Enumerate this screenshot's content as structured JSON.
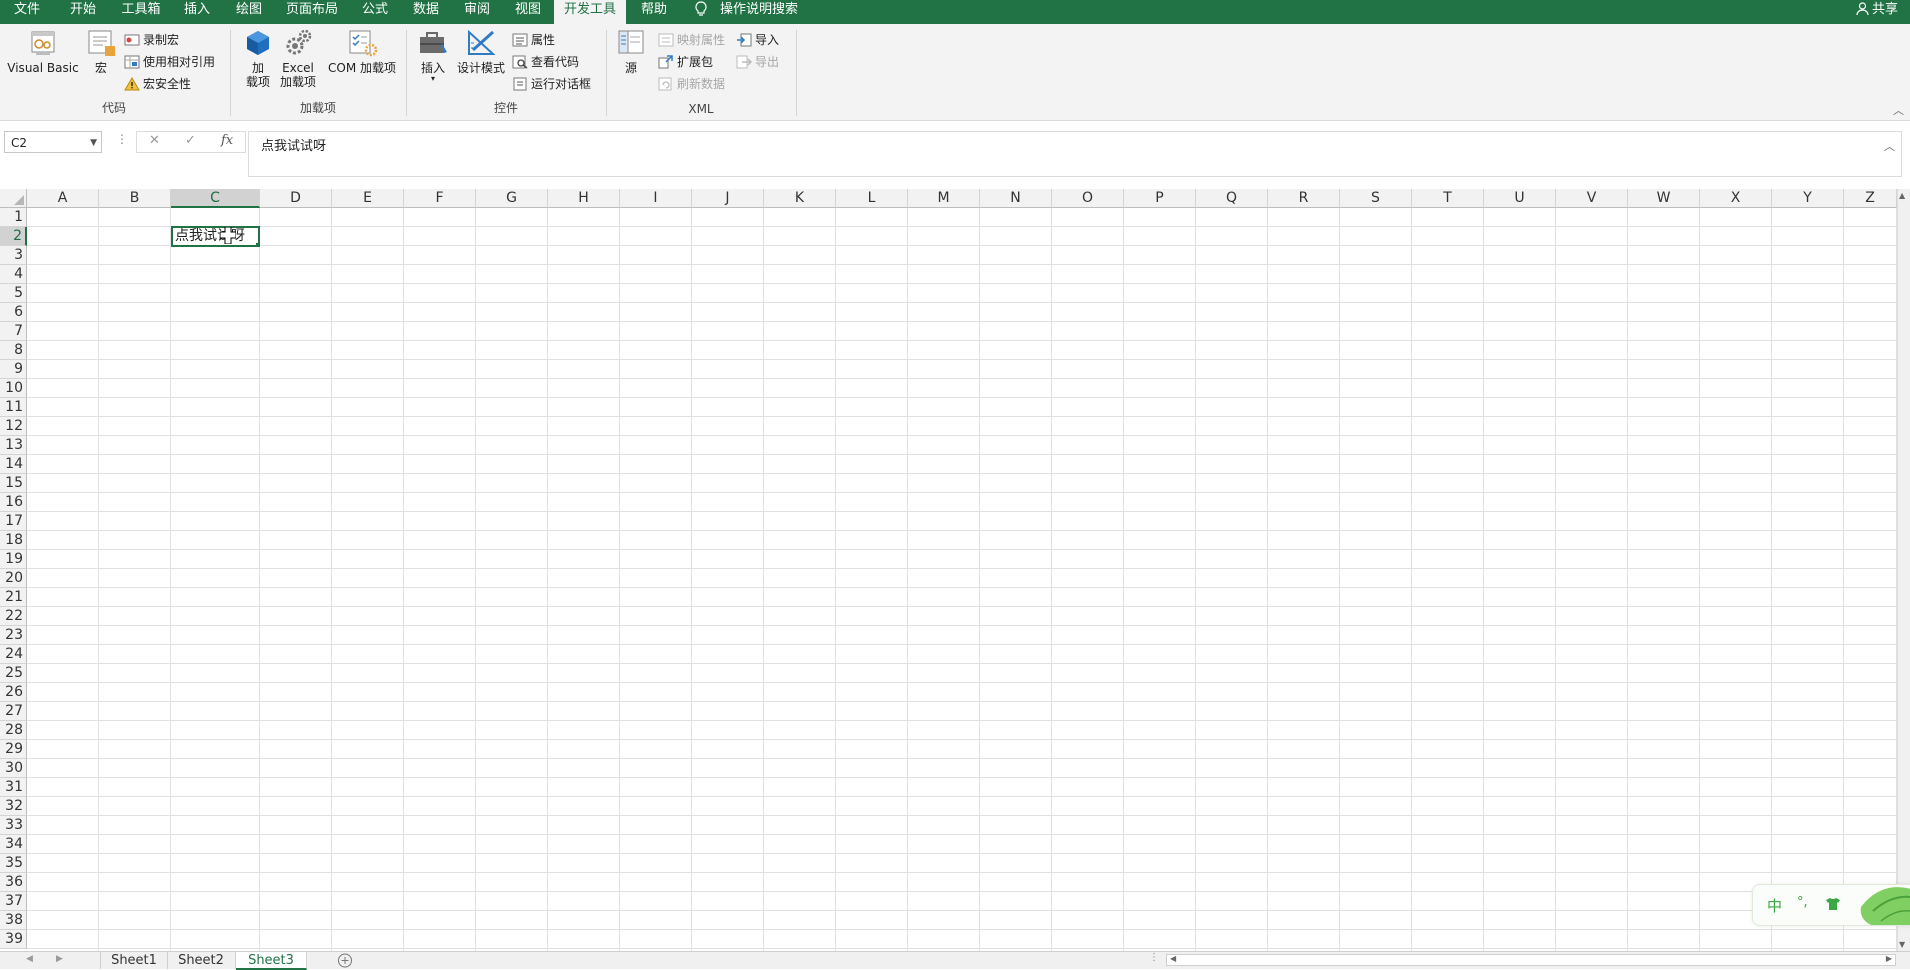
{
  "menu": {
    "tabs": [
      {
        "label": "文件"
      },
      {
        "label": "开始"
      },
      {
        "label": "工具箱"
      },
      {
        "label": "插入"
      },
      {
        "label": "绘图"
      },
      {
        "label": "页面布局"
      },
      {
        "label": "公式"
      },
      {
        "label": "数据"
      },
      {
        "label": "审阅"
      },
      {
        "label": "视图"
      },
      {
        "label": "开发工具",
        "active": true
      },
      {
        "label": "帮助"
      }
    ],
    "search_label": "操作说明搜索",
    "share_label": "共享"
  },
  "ribbon": {
    "code": {
      "group_label": "代码",
      "visual_basic": "Visual Basic",
      "macros": "宏",
      "record_macro": "录制宏",
      "relative_ref": "使用相对引用",
      "macro_security": "宏安全性"
    },
    "addins": {
      "group_label": "加载项",
      "addins_line1": "加",
      "addins_line2": "载项",
      "excel_addins_line1": "Excel",
      "excel_addins_line2": "加载项",
      "com_addins": "COM 加载项"
    },
    "controls": {
      "group_label": "控件",
      "insert": "插入",
      "design_mode": "设计模式",
      "properties": "属性",
      "view_code": "查看代码",
      "run_dialog": "运行对话框"
    },
    "xml": {
      "group_label": "XML",
      "source": "源",
      "map_properties": "映射属性",
      "expansion_packs": "扩展包",
      "refresh_data": "刷新数据",
      "import": "导入",
      "export": "导出"
    }
  },
  "formula_bar": {
    "name_box": "C2",
    "cancel_symbol": "✕",
    "enter_symbol": "✓",
    "fx_label": "fx",
    "value": "点我试试呀"
  },
  "grid": {
    "columns": [
      "A",
      "B",
      "C",
      "D",
      "E",
      "F",
      "G",
      "H",
      "I",
      "J",
      "K",
      "L",
      "M",
      "N",
      "O",
      "P",
      "Q",
      "R",
      "S",
      "T",
      "U",
      "V",
      "W",
      "X",
      "Y",
      "Z"
    ],
    "row_count": 39,
    "selected_cell": {
      "column": "C",
      "row": 2,
      "value": "点我试试呀"
    }
  },
  "ime": {
    "mode": "中",
    "punct": "°,"
  },
  "sheets": {
    "tabs": [
      "Sheet1",
      "Sheet2",
      "Sheet3"
    ],
    "active": "Sheet3"
  },
  "colors": {
    "accent": "#217346",
    "disabled": "#a6a6a6"
  }
}
